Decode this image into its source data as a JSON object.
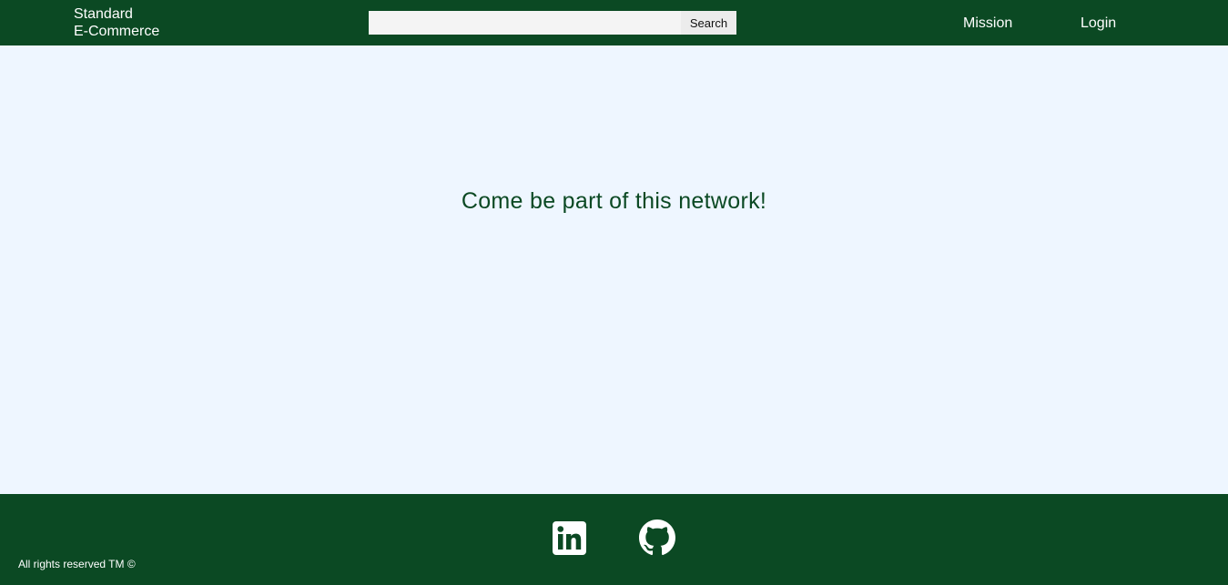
{
  "header": {
    "brand_line1": "Standard",
    "brand_line2": "E-Commerce",
    "search_placeholder": "",
    "search_value": "",
    "search_button_label": "Search",
    "nav": {
      "mission_label": "Mission",
      "login_label": "Login"
    }
  },
  "main": {
    "headline": "Come be part of this network!"
  },
  "footer": {
    "social_icons": [
      "linkedin-icon",
      "github-icon"
    ],
    "copyright": "All rights reserved TM ©"
  },
  "colors": {
    "brand_green": "#0b4923",
    "page_background": "#eef6ff",
    "text_on_dark": "#ffffff"
  }
}
